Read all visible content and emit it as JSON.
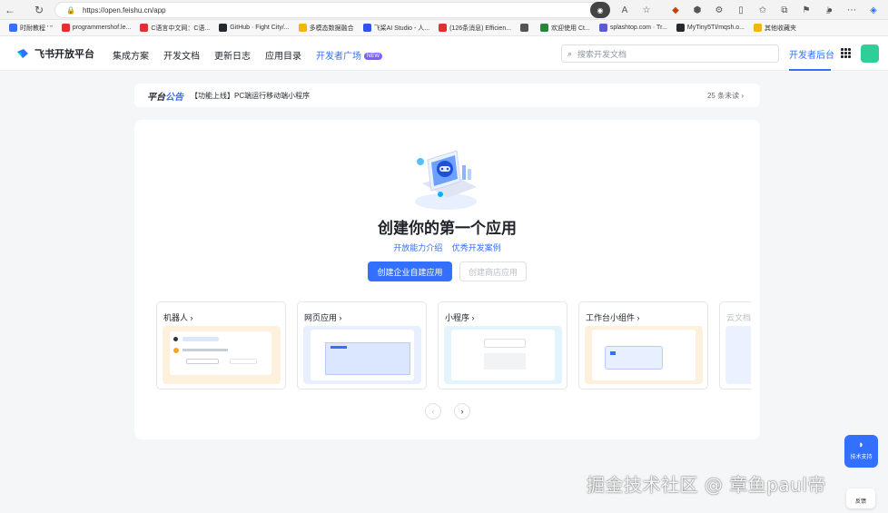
{
  "browser": {
    "url": "https://open.feishu.cn/app"
  },
  "bookmarks": [
    {
      "label": "时耐教程 ' \"",
      "color": "#3370ff"
    },
    {
      "label": "programmershof.le...",
      "color": "#e03131"
    },
    {
      "label": "C语言中文网：C语...",
      "color": "#e03131"
    },
    {
      "label": "GitHub · Fight City/...",
      "color": "#24292f"
    },
    {
      "label": "多模态数据融合",
      "color": "#f2b705"
    },
    {
      "label": "飞桨AI Studio - 人...",
      "color": "#2f54eb"
    },
    {
      "label": "(126条消息) Efficien...",
      "color": "#e03131"
    },
    {
      "label": "",
      "color": "#555555"
    },
    {
      "label": "欢迎使用 Ct...",
      "color": "#1f8a3a"
    },
    {
      "label": "splashtop.com · Tr...",
      "color": "#5b5bd6"
    },
    {
      "label": "MyTiny5TI/mqsh.o...",
      "color": "#24292f"
    },
    {
      "label": "其他收藏夹",
      "color": "#f2b705"
    }
  ],
  "header": {
    "brand": "飞书开放平台",
    "nav": [
      "集成方案",
      "开发文档",
      "更新日志",
      "应用目录"
    ],
    "nav_active": "开发者广场",
    "new_badge": "NEW",
    "search_placeholder": "搜索开发文档",
    "dev_console": "开发者后台"
  },
  "announcement": {
    "title_a": "平台",
    "title_b": "公告",
    "text": "【功能上线】PC端运行移动端小程序",
    "count": "25 条未读"
  },
  "main": {
    "title": "创建你的第一个应用",
    "link_1": "开放能力介绍",
    "link_2": "优秀开发案例",
    "primary_btn": "创建企业自建应用",
    "secondary_btn": "创建商店应用"
  },
  "categories": [
    {
      "label": "机器人",
      "preview_color": "#fdf1de"
    },
    {
      "label": "网页应用",
      "preview_color": "#e8efff"
    },
    {
      "label": "小程序",
      "preview_color": "#e3f4fc"
    },
    {
      "label": "工作台小组件",
      "preview_color": "#fdf1de"
    },
    {
      "label": "云文档",
      "preview_color": "#ecf1ff"
    }
  ],
  "float": {
    "support": "技术支持",
    "feedback": "反馈"
  },
  "watermark": "掘金技术社区 @ 章鱼paul帝"
}
